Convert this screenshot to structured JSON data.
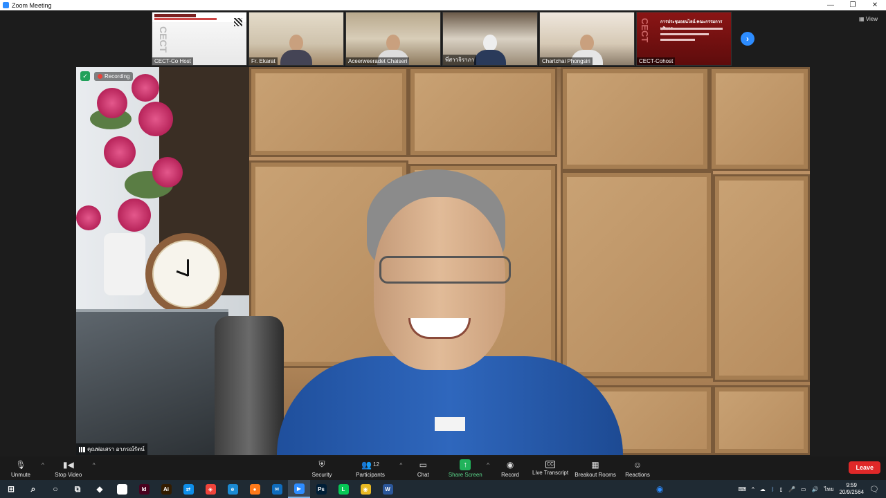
{
  "window": {
    "title": "Zoom Meeting",
    "controls": {
      "minimize": "—",
      "restore": "❐",
      "close": "✕"
    }
  },
  "view_label": "View",
  "thumbnails": [
    {
      "name": "CECT-Co Host"
    },
    {
      "name": "Fr. Ekarat"
    },
    {
      "name": "Aceerweeradet Chaiseri"
    },
    {
      "name": "พี่สาวจิราภา"
    },
    {
      "name": "Chartchai Phongsiri"
    },
    {
      "name": "CECT-Cohost"
    }
  ],
  "slide1": {
    "vertical_text": "CECT"
  },
  "slide2": {
    "title": "การประชุมออนไลน์ คณะกรรมการบริหาร",
    "vertical_text": "CECT"
  },
  "main_video": {
    "recording_label": "Recording",
    "speaker_name": "คุณพ่อเสรา อาภรณ์รัตน์"
  },
  "toolbar": {
    "unmute": "Unmute",
    "stop_video": "Stop Video",
    "security": "Security",
    "participants": "Participants",
    "participants_count": "12",
    "chat": "Chat",
    "share_screen": "Share Screen",
    "record": "Record",
    "live_transcript": "Live Transcript",
    "breakout_rooms": "Breakout Rooms",
    "reactions": "Reactions",
    "leave": "Leave"
  },
  "taskbar": {
    "apps": [
      {
        "name": "windows-start",
        "glyph": "⊞",
        "color": "#ffffff"
      },
      {
        "name": "search",
        "glyph": "⌕",
        "color": "#ffffff"
      },
      {
        "name": "cortana",
        "glyph": "○",
        "color": "#ffffff"
      },
      {
        "name": "task-view",
        "glyph": "⧉",
        "color": "#ffffff"
      },
      {
        "name": "dropbox",
        "glyph": "◆",
        "color": "#ffffff"
      },
      {
        "name": "github",
        "glyph": "●",
        "color": "#ffffff"
      },
      {
        "name": "indesign",
        "glyph": "Id",
        "color": "#49021f"
      },
      {
        "name": "illustrator",
        "glyph": "Ai",
        "color": "#331c00"
      },
      {
        "name": "teamviewer",
        "glyph": "⇄",
        "color": "#0e8ee9"
      },
      {
        "name": "anydesk",
        "glyph": "◈",
        "color": "#ef443b"
      },
      {
        "name": "edge",
        "glyph": "e",
        "color": "#1b8ad3"
      },
      {
        "name": "firefox",
        "glyph": "●",
        "color": "#ff7a1a"
      },
      {
        "name": "mail",
        "glyph": "✉",
        "color": "#0f6cbd"
      },
      {
        "name": "zoom",
        "glyph": "▶",
        "color": "#2d8cff"
      },
      {
        "name": "photoshop",
        "glyph": "Ps",
        "color": "#001e36"
      },
      {
        "name": "line",
        "glyph": "L",
        "color": "#06c755"
      },
      {
        "name": "chrome",
        "glyph": "◉",
        "color": "#e8b923"
      },
      {
        "name": "word",
        "glyph": "W",
        "color": "#2b579a"
      }
    ],
    "tray": {
      "language": "ไทย",
      "time": "9:59",
      "date": "20/9/2564"
    }
  }
}
